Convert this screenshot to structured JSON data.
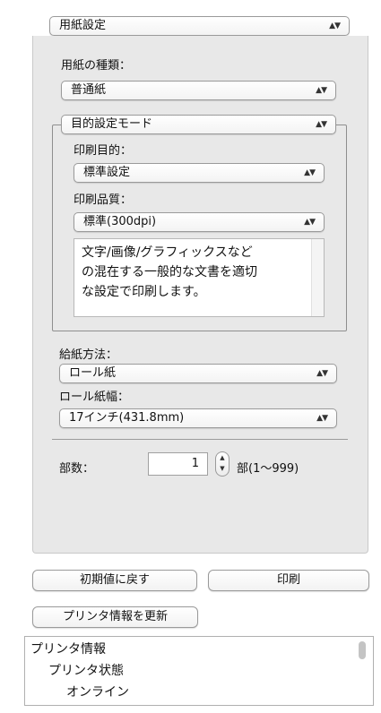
{
  "paper_setting_tab": {
    "value": "用紙設定"
  },
  "paper_type": {
    "label": "用紙の種類：",
    "value": "普通紙"
  },
  "purpose_mode": {
    "value": "目的設定モード"
  },
  "print_purpose": {
    "label": "印刷目的：",
    "value": "標準設定"
  },
  "print_quality": {
    "label": "印刷品質：",
    "value": "標準(300dpi)"
  },
  "description": {
    "lines": [
      "文字/画像/グラフィックスなど",
      "の混在する一般的な文書を適切",
      "な設定で印刷します。"
    ]
  },
  "feed_method": {
    "label": "給紙方法：",
    "value": "ロール紙"
  },
  "roll_width": {
    "label": "ロール紙幅：",
    "value": "17インチ(431.8mm)"
  },
  "copies": {
    "label": "部数：",
    "value": "1",
    "range": "部(1〜999)"
  },
  "buttons": {
    "reset": "初期値に戻す",
    "print": "印刷",
    "update_printer_info": "プリンタ情報を更新"
  },
  "printer_info": {
    "lines": [
      "プリンタ情報",
      "プリンタ状態",
      "オンライン"
    ]
  },
  "colors": {
    "panel_bg": "#e8e8e8",
    "border": "#9a9a9a"
  }
}
